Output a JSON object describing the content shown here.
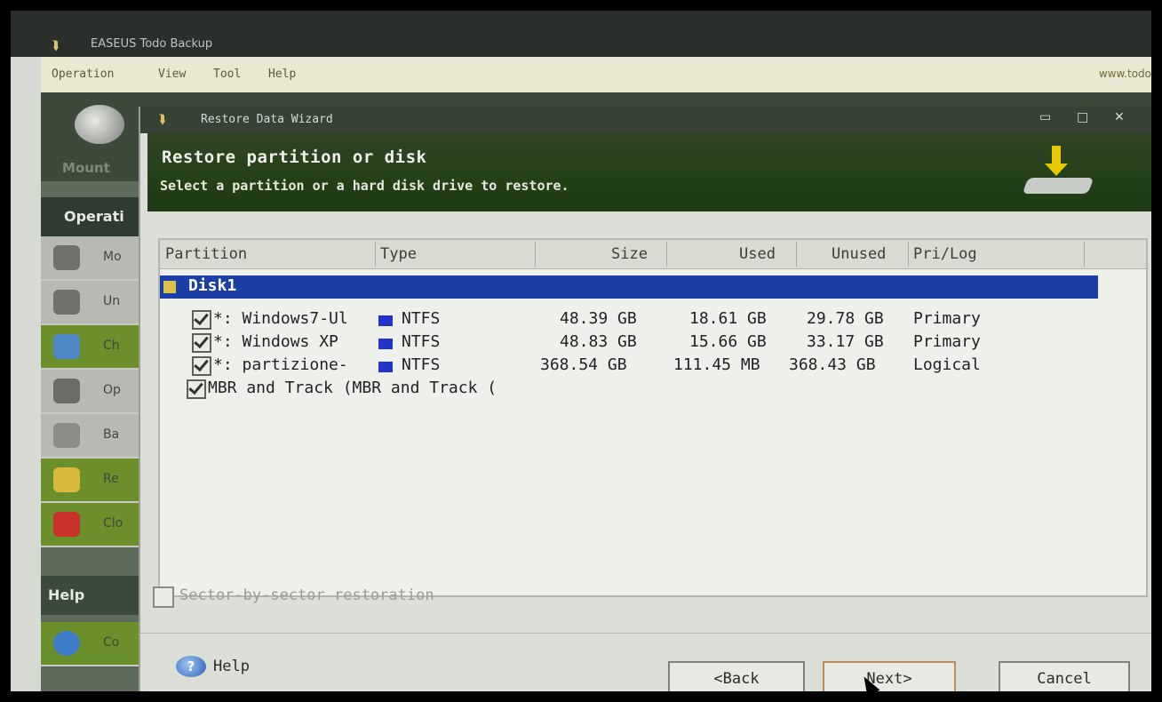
{
  "app": {
    "title": "EASEUS Todo Backup",
    "menu": [
      "Operation",
      "View",
      "Tool",
      "Help"
    ],
    "url": "www.todo",
    "toolbar": {
      "mount_label": "Mount"
    },
    "sidebar": {
      "operations_heading": "Operati",
      "items": [
        {
          "label": "Mo",
          "icon": "mount-icon"
        },
        {
          "label": "Un",
          "icon": "unmount-icon"
        },
        {
          "label": "Ch",
          "icon": "check-icon"
        },
        {
          "label": "Op",
          "icon": "options-icon"
        },
        {
          "label": "Ba",
          "icon": "backup-icon"
        },
        {
          "label": "Re",
          "icon": "restore-icon"
        },
        {
          "label": "Clo",
          "icon": "clone-icon"
        }
      ],
      "help_heading": "Help",
      "help_item": "Co"
    }
  },
  "wizard": {
    "title": "Restore Data Wizard",
    "window_controls": {
      "minimize": "▭",
      "maximize": "□",
      "close": "✕"
    },
    "header_title": "Restore partition or disk",
    "header_subtitle": "Select a partition or a hard disk drive to restore.",
    "columns": [
      "Partition",
      "Type",
      "Size",
      "Used",
      "Unused",
      "Pri/Log"
    ],
    "disk": {
      "label": "Disk1",
      "checked": true
    },
    "partitions": [
      {
        "name": "*: Windows7-Ul",
        "type": "NTFS",
        "size": "48.39 GB",
        "used": "18.61 GB",
        "unused": "29.78 GB",
        "prilog": "Primary",
        "checked": true
      },
      {
        "name": "*: Windows XP",
        "type": "NTFS",
        "size": "48.83 GB",
        "used": "15.66 GB",
        "unused": "33.17 GB",
        "prilog": "Primary",
        "checked": true
      },
      {
        "name": "*: partizione-",
        "type": "NTFS",
        "size": "368.54 GB",
        "used": "111.45 MB",
        "unused": "368.43 GB",
        "prilog": "Logical",
        "checked": true
      }
    ],
    "mbr": {
      "label": "MBR and Track (MBR and Track (",
      "checked": true
    },
    "sector_by_sector": {
      "label": "Sector-by-sector restoration",
      "checked": false
    },
    "buttons": {
      "help": "Help",
      "back": "<Back",
      "next": "Next>",
      "cancel": "Cancel"
    },
    "colors": {
      "header_green": "#234018",
      "selection_blue": "#1c3fa6",
      "ntfs_marker": "#2233cc"
    }
  }
}
